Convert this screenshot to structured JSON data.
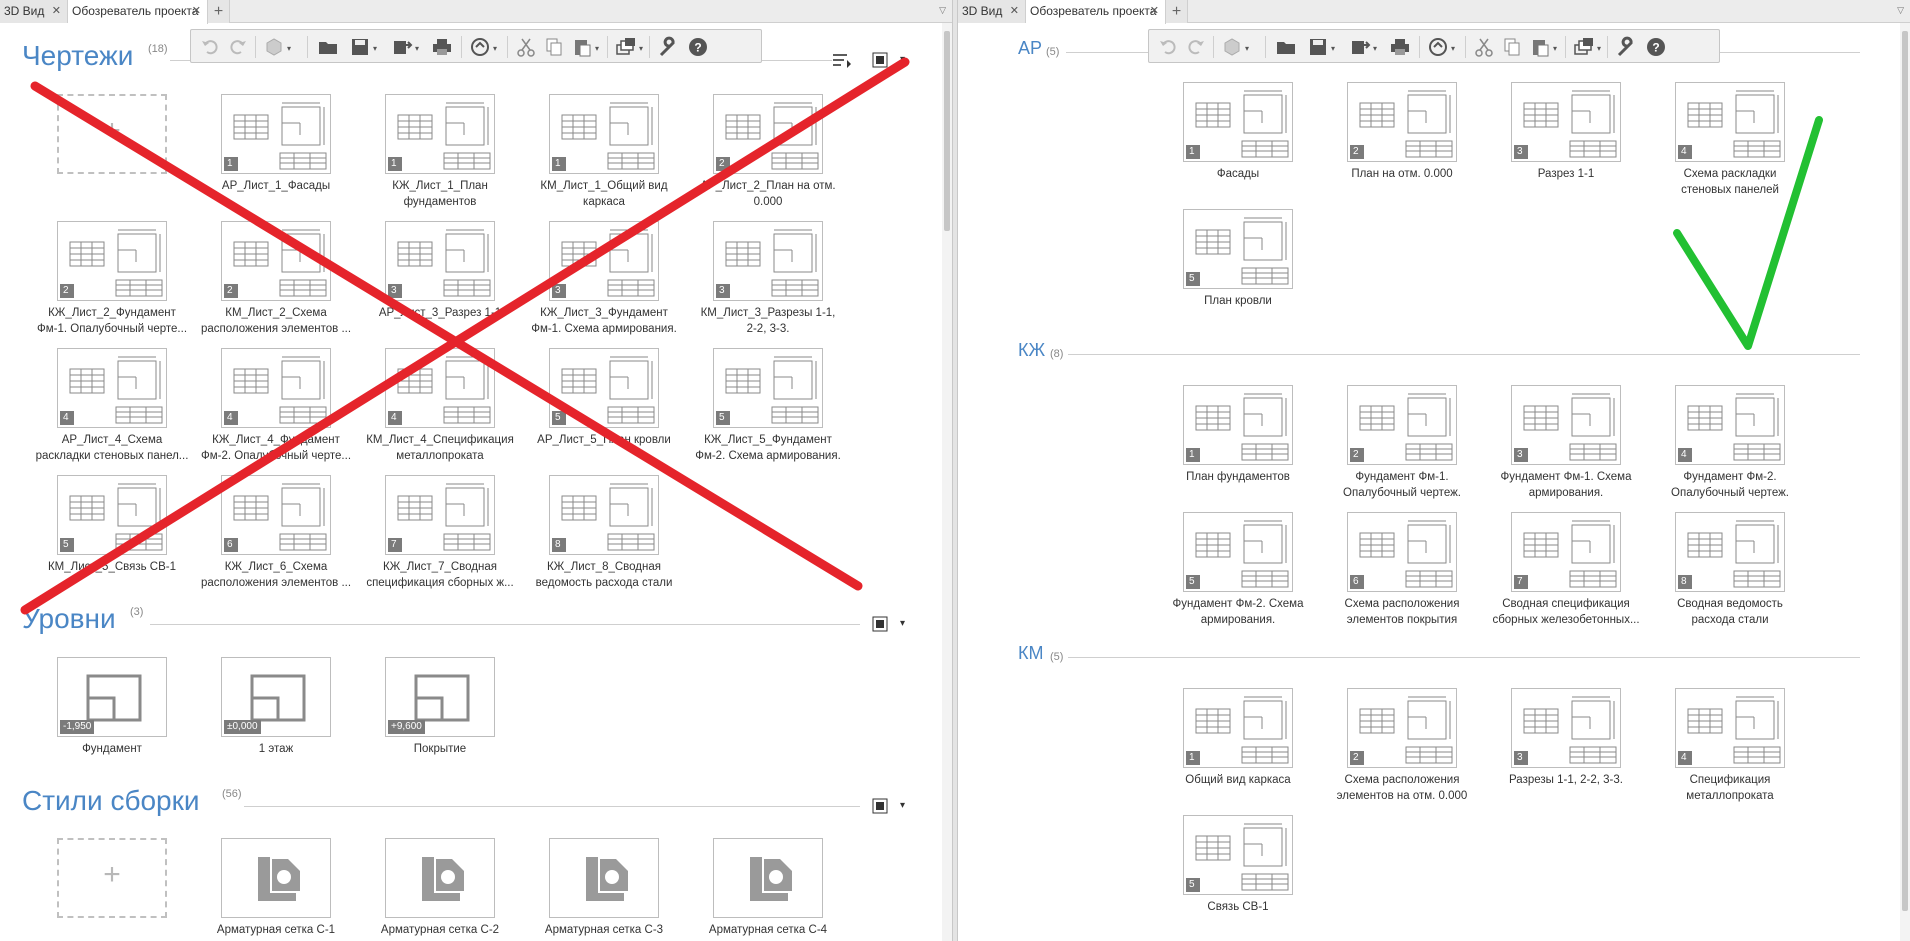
{
  "tabs_left": [
    {
      "label": "3D Вид"
    },
    {
      "label": "Обозреватель проекта"
    }
  ],
  "tabs_right": [
    {
      "label": "3D Вид"
    },
    {
      "label": "Обозреватель проекта"
    }
  ],
  "close_glyph": "✕",
  "add_tab_glyph": "+",
  "menu_glyph": "▽",
  "dropdown_glyph": "▾",
  "icons": {
    "undo": "undo-icon",
    "redo": "redo-icon",
    "box": "3d-box-icon",
    "folder": "folder-icon",
    "save": "save-icon",
    "export": "export-icon",
    "print": "print-icon",
    "cloud": "cloud-sync-icon",
    "cut": "cut-icon",
    "copy": "copy-icon",
    "paste": "paste-icon",
    "layers": "layers-icon",
    "wrench": "wrench-icon",
    "help": "help-icon",
    "help_glyph": "?"
  },
  "left": {
    "drawings": {
      "title": "Чертежи",
      "count": "(18)",
      "add_glyph": "+",
      "items": [
        {
          "badge": "1",
          "l1": "АР_Лист_1_Фасады",
          "l2": ""
        },
        {
          "badge": "1",
          "l1": "КЖ_Лист_1_План",
          "l2": "фундаментов"
        },
        {
          "badge": "1",
          "l1": "КМ_Лист_1_Общий вид",
          "l2": "каркаса"
        },
        {
          "badge": "2",
          "l1": "АР_Лист_2_План на отм.",
          "l2": "0.000"
        },
        {
          "badge": "2",
          "l1": "КЖ_Лист_2_Фундамент",
          "l2": "Фм-1. Опалубочный черте..."
        },
        {
          "badge": "2",
          "l1": "КМ_Лист_2_Схема",
          "l2": "расположения элементов ..."
        },
        {
          "badge": "3",
          "l1": "АР_Лист_3_Разрез 1-1",
          "l2": ""
        },
        {
          "badge": "3",
          "l1": "КЖ_Лист_3_Фундамент",
          "l2": "Фм-1. Схема армирования."
        },
        {
          "badge": "3",
          "l1": "КМ_Лист_3_Разрезы 1-1,",
          "l2": "2-2, 3-3."
        },
        {
          "badge": "4",
          "l1": "АР_Лист_4_Схема",
          "l2": "раскладки стеновых панел..."
        },
        {
          "badge": "4",
          "l1": "КЖ_Лист_4_Фундамент",
          "l2": "Фм-2. Опалубочный черте..."
        },
        {
          "badge": "4",
          "l1": "КМ_Лист_4_Спецификация",
          "l2": "металлопроката"
        },
        {
          "badge": "5",
          "l1": "АР_Лист_5_План кровли",
          "l2": ""
        },
        {
          "badge": "5",
          "l1": "КЖ_Лист_5_Фундамент",
          "l2": "Фм-2. Схема армирования."
        },
        {
          "badge": "5",
          "l1": "КМ_Лист_5_Связь СВ-1",
          "l2": ""
        },
        {
          "badge": "6",
          "l1": "КЖ_Лист_6_Схема",
          "l2": "расположения элементов ..."
        },
        {
          "badge": "7",
          "l1": "КЖ_Лист_7_Сводная",
          "l2": "спецификация сборных ж..."
        },
        {
          "badge": "8",
          "l1": "КЖ_Лист_8_Сводная",
          "l2": "ведомость расхода стали"
        }
      ]
    },
    "levels": {
      "title": "Уровни",
      "count": "(3)",
      "items": [
        {
          "badge": "-1,950",
          "l1": "Фундамент"
        },
        {
          "badge": "±0,000",
          "l1": "1 этаж"
        },
        {
          "badge": "+9,600",
          "l1": "Покрытие"
        }
      ]
    },
    "styles": {
      "title": "Стили сборки",
      "count": "(56)",
      "add_glyph": "+",
      "items": [
        {
          "l1": "Арматурная сетка С-1"
        },
        {
          "l1": "Арматурная сетка С-2"
        },
        {
          "l1": "Арматурная сетка С-3"
        },
        {
          "l1": "Арматурная сетка С-4"
        }
      ]
    }
  },
  "right": {
    "ar": {
      "title": "АР",
      "count": "(5)",
      "items": [
        {
          "badge": "1",
          "l1": "Фасады",
          "l2": ""
        },
        {
          "badge": "2",
          "l1": "План на отм. 0.000",
          "l2": ""
        },
        {
          "badge": "3",
          "l1": "Разрез 1-1",
          "l2": ""
        },
        {
          "badge": "4",
          "l1": "Схема раскладки",
          "l2": "стеновых панелей"
        },
        {
          "badge": "5",
          "l1": "План кровли",
          "l2": ""
        }
      ]
    },
    "kzh": {
      "title": "КЖ",
      "count": "(8)",
      "items": [
        {
          "badge": "1",
          "l1": "План фундаментов",
          "l2": ""
        },
        {
          "badge": "2",
          "l1": "Фундамент Фм-1.",
          "l2": "Опалубочный чертеж."
        },
        {
          "badge": "3",
          "l1": "Фундамент Фм-1. Схема",
          "l2": "армирования."
        },
        {
          "badge": "4",
          "l1": "Фундамент Фм-2.",
          "l2": "Опалубочный чертеж."
        },
        {
          "badge": "5",
          "l1": "Фундамент Фм-2. Схема",
          "l2": "армирования."
        },
        {
          "badge": "6",
          "l1": "Схема расположения",
          "l2": "элементов покрытия"
        },
        {
          "badge": "7",
          "l1": "Сводная спецификация",
          "l2": "сборных железобетонных..."
        },
        {
          "badge": "8",
          "l1": "Сводная ведомость",
          "l2": "расхода стали"
        }
      ]
    },
    "km": {
      "title": "КМ",
      "count": "(5)",
      "items": [
        {
          "badge": "1",
          "l1": "Общий вид каркаса",
          "l2": ""
        },
        {
          "badge": "2",
          "l1": "Схема расположения",
          "l2": "элементов на отм. 0.000"
        },
        {
          "badge": "3",
          "l1": "Разрезы 1-1, 2-2, 3-3.",
          "l2": ""
        },
        {
          "badge": "4",
          "l1": "Спецификация",
          "l2": "металлопроката"
        },
        {
          "badge": "5",
          "l1": "Связь СВ-1",
          "l2": ""
        }
      ]
    }
  },
  "colors": {
    "section_title": "#4a86c5",
    "red_cross": "#e5242b",
    "green_check": "#22c032"
  },
  "overlay": {
    "left_mark": "red-cross",
    "right_mark": "green-checkmark"
  }
}
